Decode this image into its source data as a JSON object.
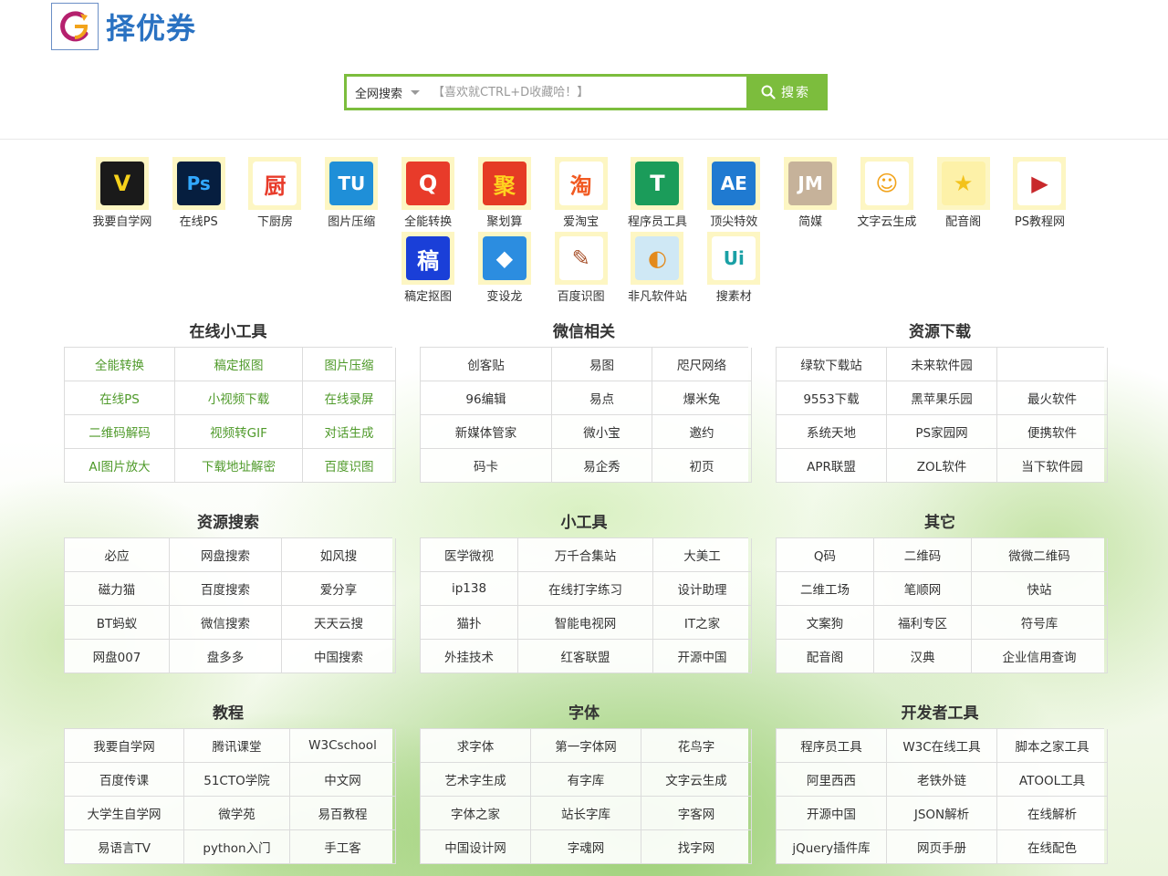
{
  "logo": {
    "text": "择优券"
  },
  "search": {
    "scope": "全网搜索",
    "placeholder": "【喜欢就CTRL+D收藏哈！】",
    "button": "搜索"
  },
  "apps": [
    {
      "label": "我要自学网",
      "glyph": "V",
      "icon": "vwin-logo-icon",
      "bg": "#1a1a1a",
      "fg": "#f6d21b"
    },
    {
      "label": "在线PS",
      "glyph": "Ps",
      "icon": "photoshop-icon",
      "bg": "#061e3f",
      "fg": "#31a8ff"
    },
    {
      "label": "下厨房",
      "glyph": "厨",
      "icon": "kitchen-icon",
      "bg": "#ffffff",
      "fg": "#e83b2a"
    },
    {
      "label": "图片压缩",
      "glyph": "TU",
      "icon": "tinypng-icon",
      "bg": "#1f8fd8",
      "fg": "#ffffff"
    },
    {
      "label": "全能转换",
      "glyph": "Q",
      "icon": "converter-icon",
      "bg": "#e83b2a",
      "fg": "#ffffff"
    },
    {
      "label": "聚划算",
      "glyph": "聚",
      "icon": "juhuasuan-icon",
      "bg": "#e53b24",
      "fg": "#ffd21f"
    },
    {
      "label": "爱淘宝",
      "glyph": "淘",
      "icon": "taobao-icon",
      "bg": "#ffffff",
      "fg": "#f15a22"
    },
    {
      "label": "程序员工具",
      "glyph": "T",
      "icon": "devtool-icon",
      "bg": "#1b9c5a",
      "fg": "#ffffff"
    },
    {
      "label": "顶尖特效",
      "glyph": "AE",
      "icon": "aftereffects-icon",
      "bg": "#1f7ad1",
      "fg": "#ffffff"
    },
    {
      "label": "简媒",
      "glyph": "JM",
      "icon": "jianmei-icon",
      "bg": "#c6b29a",
      "fg": "#ffffff"
    },
    {
      "label": "文字云生成",
      "glyph": "☺",
      "icon": "wordcloud-icon",
      "bg": "#ffffff",
      "fg": "#f2a31b"
    },
    {
      "label": "配音阁",
      "glyph": "★",
      "icon": "star-icon",
      "bg": "#fdf1a8",
      "fg": "#f3c21b"
    },
    {
      "label": "PS教程网",
      "glyph": "▶",
      "icon": "play-icon",
      "bg": "#ffffff",
      "fg": "#c8282c"
    },
    {
      "label": "稿定抠图",
      "glyph": "稿",
      "icon": "gaoding-icon",
      "bg": "#1a3fd8",
      "fg": "#ffffff"
    },
    {
      "label": "变设龙",
      "glyph": "◆",
      "icon": "bianshelong-icon",
      "bg": "#2c8de0",
      "fg": "#ffffff"
    },
    {
      "label": "百度识图",
      "glyph": "✎",
      "icon": "baidu-shitu-icon",
      "bg": "#ffffff",
      "fg": "#a8522c"
    },
    {
      "label": "非凡软件站",
      "glyph": "◐",
      "icon": "crsky-icon",
      "bg": "#cfe8f5",
      "fg": "#e38a1c"
    },
    {
      "label": "搜素材",
      "glyph": "Ui",
      "icon": "sousucai-icon",
      "bg": "#ffffff",
      "fg": "#1aa0a5"
    }
  ],
  "sections": [
    {
      "title": "在线小工具",
      "rows": [
        [
          "全能转换",
          "稿定抠图",
          "图片压缩"
        ],
        [
          "在线PS",
          "小视频下载",
          "在线录屏"
        ],
        [
          "二维码解码",
          "视频转GIF",
          "对话生成"
        ],
        [
          "AI图片放大",
          "下载地址解密",
          "百度识图"
        ]
      ],
      "green": true
    },
    {
      "title": "微信相关",
      "rows": [
        [
          "创客贴",
          "易图",
          "咫尺网络"
        ],
        [
          "96编辑",
          "易点",
          "爆米兔"
        ],
        [
          "新媒体管家",
          "微小宝",
          "邀约"
        ],
        [
          "码卡",
          "易企秀",
          "初页"
        ]
      ],
      "green": false
    },
    {
      "title": "资源下载",
      "rows": [
        [
          "绿软下载站",
          "未来软件园",
          ""
        ],
        [
          "9553下载",
          "黑苹果乐园",
          "最火软件"
        ],
        [
          "系统天地",
          "PS家园网",
          "便携软件"
        ],
        [
          "APR联盟",
          "ZOL软件",
          "当下软件园"
        ]
      ],
      "green": false
    },
    {
      "title": "资源搜索",
      "rows": [
        [
          "必应",
          "网盘搜索",
          "如风搜"
        ],
        [
          "磁力猫",
          "百度搜索",
          "爱分享"
        ],
        [
          "BT蚂蚁",
          "微信搜索",
          "天天云搜"
        ],
        [
          "网盘007",
          "盘多多",
          "中国搜索"
        ]
      ],
      "green": false
    },
    {
      "title": "小工具",
      "rows": [
        [
          "医学微视",
          "万千合集站",
          "大美工"
        ],
        [
          "ip138",
          "在线打字练习",
          "设计助理"
        ],
        [
          "猫扑",
          "智能电视网",
          "IT之家"
        ],
        [
          "外挂技术",
          "红客联盟",
          "开源中国"
        ]
      ],
      "green": false
    },
    {
      "title": "其它",
      "rows": [
        [
          "Q码",
          "二维码",
          "微微二维码"
        ],
        [
          "二维工场",
          "笔顺网",
          "快站"
        ],
        [
          "文案狗",
          "福利专区",
          "符号库"
        ],
        [
          "配音阁",
          "汉典",
          "企业信用查询"
        ]
      ],
      "green": false
    },
    {
      "title": "教程",
      "rows": [
        [
          "我要自学网",
          "腾讯课堂",
          "W3Cschool"
        ],
        [
          "百度传课",
          "51CTO学院",
          "中文网"
        ],
        [
          "大学生自学网",
          "微学苑",
          "易百教程"
        ],
        [
          "易语言TV",
          "python入门",
          "手工客"
        ]
      ],
      "green": false
    },
    {
      "title": "字体",
      "rows": [
        [
          "求字体",
          "第一字体网",
          "花鸟字"
        ],
        [
          "艺术字生成",
          "有字库",
          "文字云生成"
        ],
        [
          "字体之家",
          "站长字库",
          "字客网"
        ],
        [
          "中国设计网",
          "字魂网",
          "找字网"
        ]
      ],
      "green": false
    },
    {
      "title": "开发者工具",
      "rows": [
        [
          "程序员工具",
          "W3C在线工具",
          "脚本之家工具"
        ],
        [
          "阿里西西",
          "老铁外链",
          "ATOOL工具"
        ],
        [
          "开源中国",
          "JSON解析",
          "在线解析"
        ],
        [
          "jQuery插件库",
          "网页手册",
          "在线配色"
        ]
      ],
      "green": false
    }
  ],
  "colors": {
    "accent": "#7cbd3d",
    "link_green": "#4f9a2a",
    "logo_blue": "#2a72c2"
  }
}
